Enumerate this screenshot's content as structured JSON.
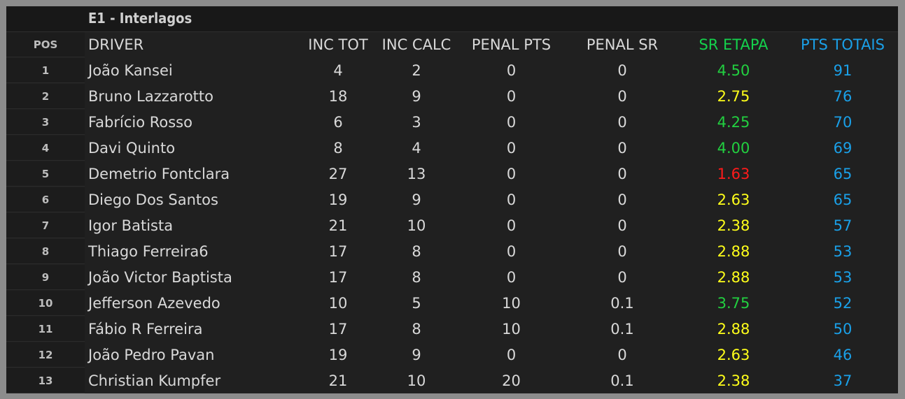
{
  "title": "E1 - Interlagos",
  "headers": {
    "pos": "POS",
    "driver": "DRIVER",
    "inc_tot": "INC TOT",
    "inc_calc": "INC CALC",
    "penal_pts": "PENAL PTS",
    "penal_sr": "PENAL SR",
    "sr_etapa": "SR ETAPA",
    "pts_totais": "PTS TOTAIS"
  },
  "colors": {
    "sr_green": "#22d040",
    "sr_yellow": "#ffff1a",
    "sr_red": "#ff1a1a",
    "pts_blue": "#1aa0e8"
  },
  "rows": [
    {
      "pos": "1",
      "driver": "João Kansei",
      "inc_tot": "4",
      "inc_calc": "2",
      "penal_pts": "0",
      "penal_sr": "0",
      "sr_etapa": "4.50",
      "sr_color": "green",
      "pts_totais": "91"
    },
    {
      "pos": "2",
      "driver": "Bruno Lazzarotto",
      "inc_tot": "18",
      "inc_calc": "9",
      "penal_pts": "0",
      "penal_sr": "0",
      "sr_etapa": "2.75",
      "sr_color": "yellow",
      "pts_totais": "76"
    },
    {
      "pos": "3",
      "driver": "Fabrício Rosso",
      "inc_tot": "6",
      "inc_calc": "3",
      "penal_pts": "0",
      "penal_sr": "0",
      "sr_etapa": "4.25",
      "sr_color": "green",
      "pts_totais": "70"
    },
    {
      "pos": "4",
      "driver": "Davi Quinto",
      "inc_tot": "8",
      "inc_calc": "4",
      "penal_pts": "0",
      "penal_sr": "0",
      "sr_etapa": "4.00",
      "sr_color": "green",
      "pts_totais": "69"
    },
    {
      "pos": "5",
      "driver": "Demetrio Fontclara",
      "inc_tot": "27",
      "inc_calc": "13",
      "penal_pts": "0",
      "penal_sr": "0",
      "sr_etapa": "1.63",
      "sr_color": "red",
      "pts_totais": "65"
    },
    {
      "pos": "6",
      "driver": "Diego Dos Santos",
      "inc_tot": "19",
      "inc_calc": "9",
      "penal_pts": "0",
      "penal_sr": "0",
      "sr_etapa": "2.63",
      "sr_color": "yellow",
      "pts_totais": "65"
    },
    {
      "pos": "7",
      "driver": "Igor Batista",
      "inc_tot": "21",
      "inc_calc": "10",
      "penal_pts": "0",
      "penal_sr": "0",
      "sr_etapa": "2.38",
      "sr_color": "yellow",
      "pts_totais": "57"
    },
    {
      "pos": "8",
      "driver": "Thiago Ferreira6",
      "inc_tot": "17",
      "inc_calc": "8",
      "penal_pts": "0",
      "penal_sr": "0",
      "sr_etapa": "2.88",
      "sr_color": "yellow",
      "pts_totais": "53"
    },
    {
      "pos": "9",
      "driver": "João Victor Baptista",
      "inc_tot": "17",
      "inc_calc": "8",
      "penal_pts": "0",
      "penal_sr": "0",
      "sr_etapa": "2.88",
      "sr_color": "yellow",
      "pts_totais": "53"
    },
    {
      "pos": "10",
      "driver": "Jefferson Azevedo",
      "inc_tot": "10",
      "inc_calc": "5",
      "penal_pts": "10",
      "penal_sr": "0.1",
      "sr_etapa": "3.75",
      "sr_color": "green",
      "pts_totais": "52"
    },
    {
      "pos": "11",
      "driver": "Fábio R Ferreira",
      "inc_tot": "17",
      "inc_calc": "8",
      "penal_pts": "10",
      "penal_sr": "0.1",
      "sr_etapa": "2.88",
      "sr_color": "yellow",
      "pts_totais": "50"
    },
    {
      "pos": "12",
      "driver": "João Pedro Pavan",
      "inc_tot": "19",
      "inc_calc": "9",
      "penal_pts": "0",
      "penal_sr": "0",
      "sr_etapa": "2.63",
      "sr_color": "yellow",
      "pts_totais": "46"
    },
    {
      "pos": "13",
      "driver": "Christian Kumpfer",
      "inc_tot": "21",
      "inc_calc": "10",
      "penal_pts": "20",
      "penal_sr": "0.1",
      "sr_etapa": "2.38",
      "sr_color": "yellow",
      "pts_totais": "37"
    }
  ]
}
